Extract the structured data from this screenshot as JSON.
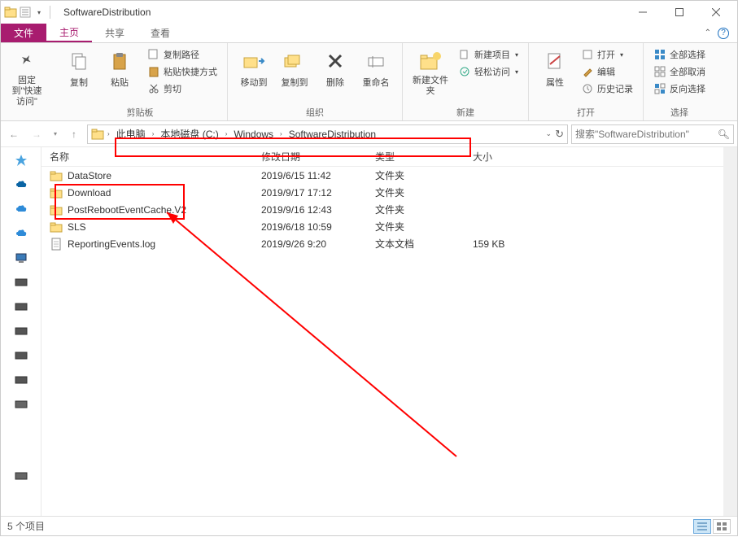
{
  "title": "SoftwareDistribution",
  "tabs": {
    "file": "文件",
    "home": "主页",
    "share": "共享",
    "view": "查看"
  },
  "ribbon": {
    "pin": {
      "label": "固定到\"快速访问\""
    },
    "copy": "复制",
    "paste": "粘贴",
    "copy_path": "复制路径",
    "paste_shortcut": "粘贴快捷方式",
    "cut": "剪切",
    "group_clipboard": "剪贴板",
    "move_to": "移动到",
    "copy_to": "复制到",
    "delete": "删除",
    "rename": "重命名",
    "group_organize": "组织",
    "new_folder": "新建文件夹",
    "new_item": "新建项目",
    "easy_access": "轻松访问",
    "group_new": "新建",
    "properties": "属性",
    "open": "打开",
    "edit": "编辑",
    "history": "历史记录",
    "group_open": "打开",
    "select_all": "全部选择",
    "select_none": "全部取消",
    "invert_selection": "反向选择",
    "group_select": "选择"
  },
  "breadcrumb": {
    "items": [
      "此电脑",
      "本地磁盘 (C:)",
      "Windows",
      "SoftwareDistribution"
    ]
  },
  "search": {
    "placeholder": "搜索\"SoftwareDistribution\""
  },
  "columns": {
    "name": "名称",
    "date": "修改日期",
    "type": "类型",
    "size": "大小"
  },
  "files": [
    {
      "name": "DataStore",
      "date": "2019/6/15 11:42",
      "type": "文件夹",
      "size": "",
      "icon": "folder"
    },
    {
      "name": "Download",
      "date": "2019/9/17 17:12",
      "type": "文件夹",
      "size": "",
      "icon": "folder"
    },
    {
      "name": "PostRebootEventCache.V2",
      "date": "2019/9/16 12:43",
      "type": "文件夹",
      "size": "",
      "icon": "folder"
    },
    {
      "name": "SLS",
      "date": "2019/6/18 10:59",
      "type": "文件夹",
      "size": "",
      "icon": "folder"
    },
    {
      "name": "ReportingEvents.log",
      "date": "2019/9/26 9:20",
      "type": "文本文档",
      "size": "159 KB",
      "icon": "file"
    }
  ],
  "status": "5 个项目"
}
